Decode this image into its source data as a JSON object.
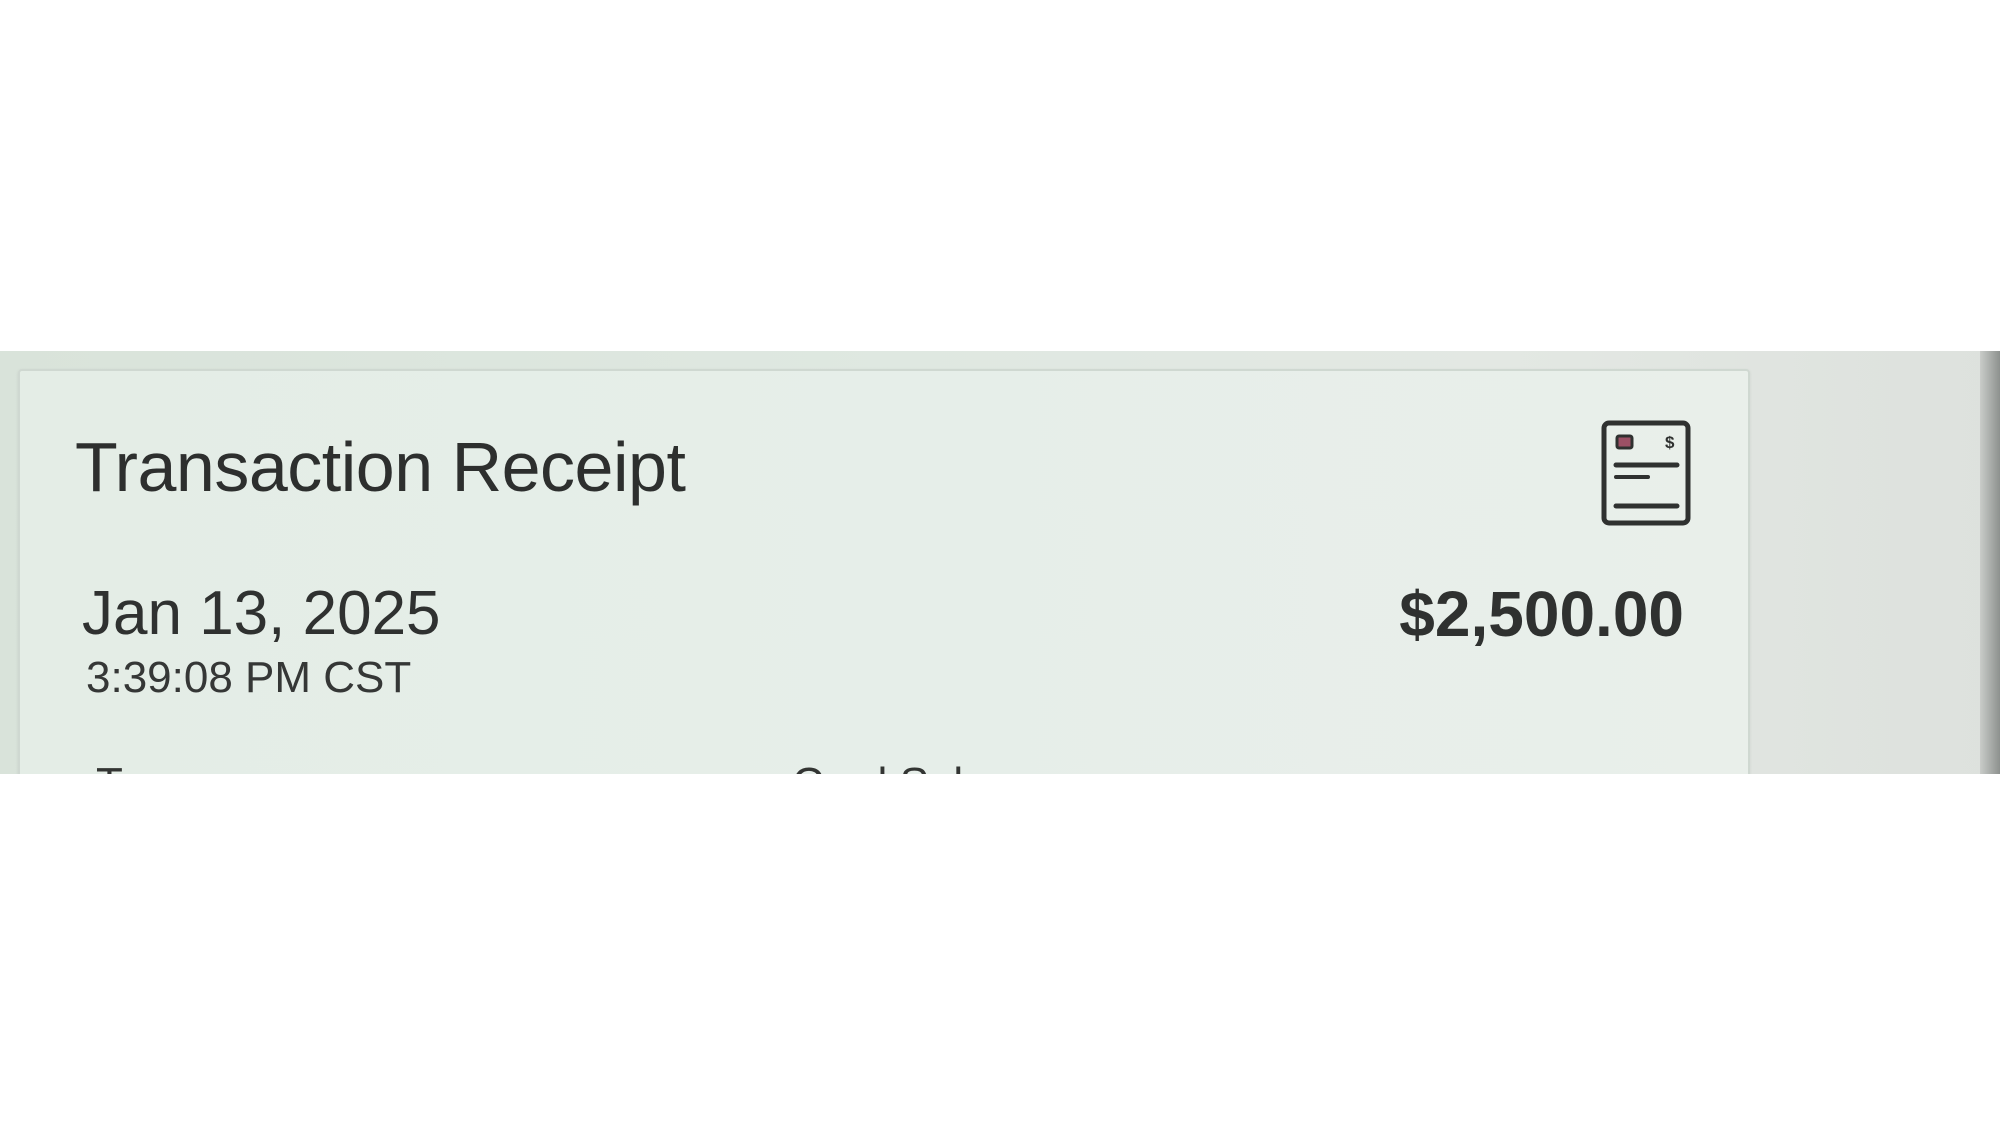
{
  "receipt": {
    "title": "Transaction Receipt",
    "icon": "receipt-icon",
    "date": "Jan 13, 2025",
    "time": "3:39:08 PM CST",
    "amount": "$2,500.00",
    "details": {
      "type_label": "Type",
      "type_value": "Card Sale"
    }
  },
  "colors": {
    "background": "#e4ede6",
    "text": "#2f3130",
    "icon_accent": "#9c5065"
  }
}
